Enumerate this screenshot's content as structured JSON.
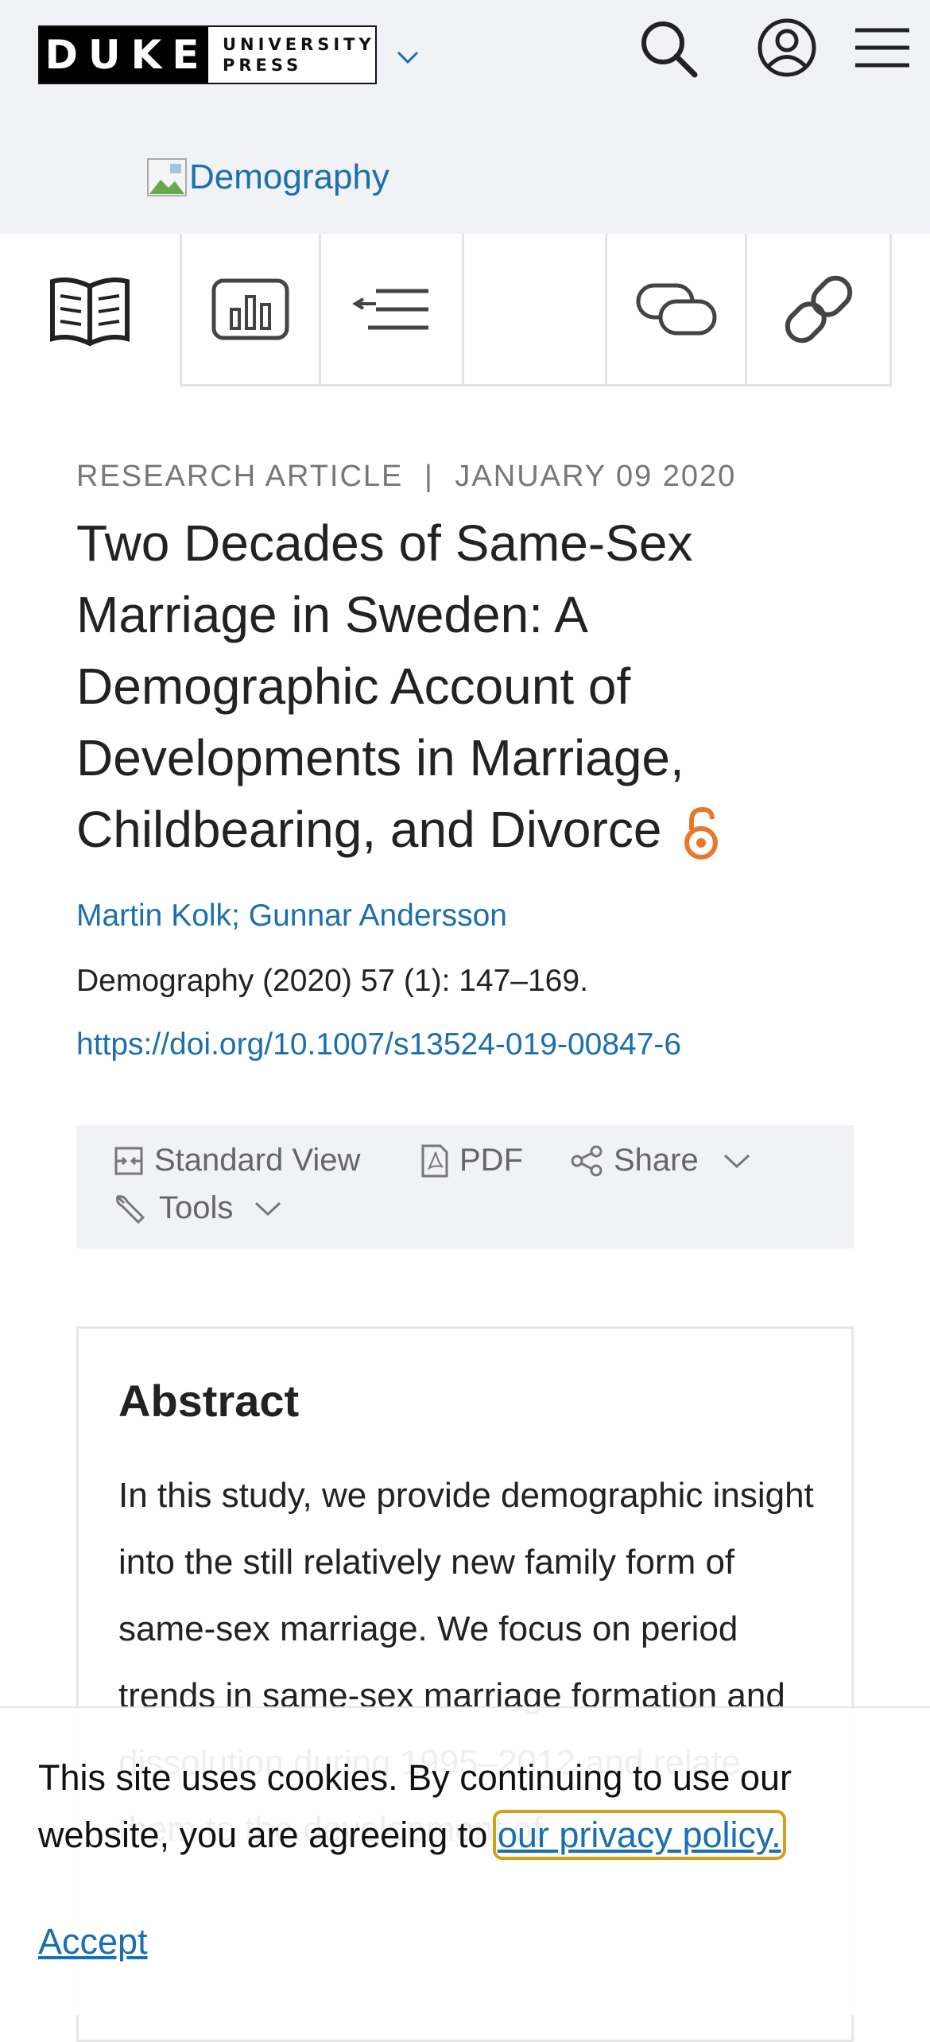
{
  "header": {
    "logo_word": "DUKE",
    "logo_line1": "UNIVERSITY",
    "logo_line2": "PRESS",
    "journal_name": "Demography",
    "icons": [
      "chevron-down-icon",
      "search-icon",
      "user-icon",
      "menu-icon"
    ]
  },
  "toolbar": {
    "icons": [
      "article-icon",
      "figures-icon",
      "outline-icon",
      "blank-tab",
      "comment-icon",
      "link-icon"
    ]
  },
  "article": {
    "type": "RESEARCH ARTICLE",
    "separator": "|",
    "date": "JANUARY 09 2020",
    "title": "Two Decades of Same-Sex Marriage in Sweden: A Demographic Account of Developments in Marriage, Childbearing, and Divorce",
    "authors": "Martin Kolk; Gunnar Andersson",
    "citation": "Demography (2020) 57 (1): 147–169.",
    "doi": "https://doi.org/10.1007/s13524-019-00847-6"
  },
  "actions": {
    "standard_view": "Standard View",
    "pdf": "PDF",
    "share": "Share",
    "tools": "Tools"
  },
  "abstract": {
    "heading": "Abstract",
    "text": "In this study, we provide demographic insight into the still relatively new family form of same-sex marriage. We focus on period trends in same-sex marriage formation and dissolution during 1995–2012 and relate them to the development of"
  },
  "cookie": {
    "text": "This site uses cookies. By continuing to use our website, you are agreeing to ",
    "privacy_link": "our privacy policy.",
    "accept": "Accept"
  },
  "colors": {
    "link": "#1b6fae",
    "header_bg": "#f1f2f5",
    "open_access": "#e8792b",
    "focus_outline": "#d4a017"
  }
}
